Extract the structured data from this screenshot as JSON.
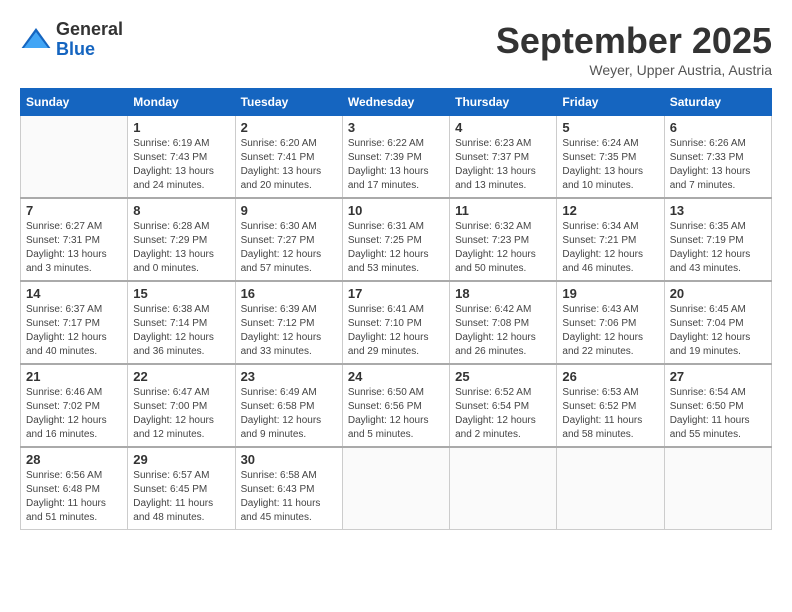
{
  "header": {
    "logo_general": "General",
    "logo_blue": "Blue",
    "month": "September 2025",
    "location": "Weyer, Upper Austria, Austria"
  },
  "columns": [
    "Sunday",
    "Monday",
    "Tuesday",
    "Wednesday",
    "Thursday",
    "Friday",
    "Saturday"
  ],
  "weeks": [
    [
      {
        "day": "",
        "info": ""
      },
      {
        "day": "1",
        "info": "Sunrise: 6:19 AM\nSunset: 7:43 PM\nDaylight: 13 hours\nand 24 minutes."
      },
      {
        "day": "2",
        "info": "Sunrise: 6:20 AM\nSunset: 7:41 PM\nDaylight: 13 hours\nand 20 minutes."
      },
      {
        "day": "3",
        "info": "Sunrise: 6:22 AM\nSunset: 7:39 PM\nDaylight: 13 hours\nand 17 minutes."
      },
      {
        "day": "4",
        "info": "Sunrise: 6:23 AM\nSunset: 7:37 PM\nDaylight: 13 hours\nand 13 minutes."
      },
      {
        "day": "5",
        "info": "Sunrise: 6:24 AM\nSunset: 7:35 PM\nDaylight: 13 hours\nand 10 minutes."
      },
      {
        "day": "6",
        "info": "Sunrise: 6:26 AM\nSunset: 7:33 PM\nDaylight: 13 hours\nand 7 minutes."
      }
    ],
    [
      {
        "day": "7",
        "info": "Sunrise: 6:27 AM\nSunset: 7:31 PM\nDaylight: 13 hours\nand 3 minutes."
      },
      {
        "day": "8",
        "info": "Sunrise: 6:28 AM\nSunset: 7:29 PM\nDaylight: 13 hours\nand 0 minutes."
      },
      {
        "day": "9",
        "info": "Sunrise: 6:30 AM\nSunset: 7:27 PM\nDaylight: 12 hours\nand 57 minutes."
      },
      {
        "day": "10",
        "info": "Sunrise: 6:31 AM\nSunset: 7:25 PM\nDaylight: 12 hours\nand 53 minutes."
      },
      {
        "day": "11",
        "info": "Sunrise: 6:32 AM\nSunset: 7:23 PM\nDaylight: 12 hours\nand 50 minutes."
      },
      {
        "day": "12",
        "info": "Sunrise: 6:34 AM\nSunset: 7:21 PM\nDaylight: 12 hours\nand 46 minutes."
      },
      {
        "day": "13",
        "info": "Sunrise: 6:35 AM\nSunset: 7:19 PM\nDaylight: 12 hours\nand 43 minutes."
      }
    ],
    [
      {
        "day": "14",
        "info": "Sunrise: 6:37 AM\nSunset: 7:17 PM\nDaylight: 12 hours\nand 40 minutes."
      },
      {
        "day": "15",
        "info": "Sunrise: 6:38 AM\nSunset: 7:14 PM\nDaylight: 12 hours\nand 36 minutes."
      },
      {
        "day": "16",
        "info": "Sunrise: 6:39 AM\nSunset: 7:12 PM\nDaylight: 12 hours\nand 33 minutes."
      },
      {
        "day": "17",
        "info": "Sunrise: 6:41 AM\nSunset: 7:10 PM\nDaylight: 12 hours\nand 29 minutes."
      },
      {
        "day": "18",
        "info": "Sunrise: 6:42 AM\nSunset: 7:08 PM\nDaylight: 12 hours\nand 26 minutes."
      },
      {
        "day": "19",
        "info": "Sunrise: 6:43 AM\nSunset: 7:06 PM\nDaylight: 12 hours\nand 22 minutes."
      },
      {
        "day": "20",
        "info": "Sunrise: 6:45 AM\nSunset: 7:04 PM\nDaylight: 12 hours\nand 19 minutes."
      }
    ],
    [
      {
        "day": "21",
        "info": "Sunrise: 6:46 AM\nSunset: 7:02 PM\nDaylight: 12 hours\nand 16 minutes."
      },
      {
        "day": "22",
        "info": "Sunrise: 6:47 AM\nSunset: 7:00 PM\nDaylight: 12 hours\nand 12 minutes."
      },
      {
        "day": "23",
        "info": "Sunrise: 6:49 AM\nSunset: 6:58 PM\nDaylight: 12 hours\nand 9 minutes."
      },
      {
        "day": "24",
        "info": "Sunrise: 6:50 AM\nSunset: 6:56 PM\nDaylight: 12 hours\nand 5 minutes."
      },
      {
        "day": "25",
        "info": "Sunrise: 6:52 AM\nSunset: 6:54 PM\nDaylight: 12 hours\nand 2 minutes."
      },
      {
        "day": "26",
        "info": "Sunrise: 6:53 AM\nSunset: 6:52 PM\nDaylight: 11 hours\nand 58 minutes."
      },
      {
        "day": "27",
        "info": "Sunrise: 6:54 AM\nSunset: 6:50 PM\nDaylight: 11 hours\nand 55 minutes."
      }
    ],
    [
      {
        "day": "28",
        "info": "Sunrise: 6:56 AM\nSunset: 6:48 PM\nDaylight: 11 hours\nand 51 minutes."
      },
      {
        "day": "29",
        "info": "Sunrise: 6:57 AM\nSunset: 6:45 PM\nDaylight: 11 hours\nand 48 minutes."
      },
      {
        "day": "30",
        "info": "Sunrise: 6:58 AM\nSunset: 6:43 PM\nDaylight: 11 hours\nand 45 minutes."
      },
      {
        "day": "",
        "info": ""
      },
      {
        "day": "",
        "info": ""
      },
      {
        "day": "",
        "info": ""
      },
      {
        "day": "",
        "info": ""
      }
    ]
  ]
}
